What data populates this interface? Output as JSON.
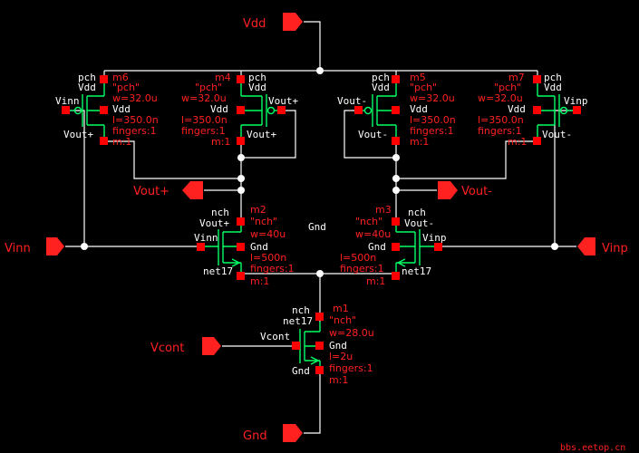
{
  "pins": {
    "vdd": "Vdd",
    "vout_plus": "Vout+",
    "vout_minus": "Vout-",
    "vinn": "Vinn",
    "vinp": "Vinp",
    "vcont": "Vcont",
    "gnd": "Gnd"
  },
  "net_gnd_label": "Gnd",
  "transistors": {
    "m6": {
      "inst": "m6",
      "type": "pch",
      "model": "\"pch\"",
      "w": "w=32.0u",
      "l": "l=350.0n",
      "fingers": "fingers:1",
      "m": "m:1",
      "gate": "Vinn",
      "drain": "Vout+",
      "source": "Vdd",
      "bulk": "Vdd"
    },
    "m4": {
      "inst": "m4",
      "type": "pch",
      "model": "\"pch\"",
      "w": "w=32.0u",
      "l": "l=350.0n",
      "fingers": "fingers:1",
      "m": "m:1",
      "gate": "Vout+",
      "drain": "Vout+",
      "source": "Vdd",
      "bulk": "Vdd"
    },
    "m5": {
      "inst": "m5",
      "type": "pch",
      "model": "\"pch\"",
      "w": "w=32.0u",
      "l": "l=350.0n",
      "fingers": "fingers:1",
      "m": "m:1",
      "gate": "Vout-",
      "drain": "Vout-",
      "source": "Vdd",
      "bulk": "Vdd"
    },
    "m7": {
      "inst": "m7",
      "type": "pch",
      "model": "\"pch\"",
      "w": "w=32.0u",
      "l": "l=350.0n",
      "fingers": "fingers:1",
      "m": "m:1",
      "gate": "Vinp",
      "drain": "Vout-",
      "source": "Vdd",
      "bulk": "Vdd"
    },
    "m2": {
      "inst": "m2",
      "type": "nch",
      "model": "\"nch\"",
      "w": "w=40u",
      "l": "l=500n",
      "fingers": "fingers:1",
      "m": "m:1",
      "gate": "Vinn",
      "drain": "Vout+",
      "source": "net17",
      "bulk": "Gnd"
    },
    "m3": {
      "inst": "m3",
      "type": "nch",
      "model": "\"nch\"",
      "w": "w=40u",
      "l": "l=500n",
      "fingers": "fingers:1",
      "m": "m:1",
      "gate": "Vinp",
      "drain": "Vout-",
      "source": "net17",
      "bulk": "Gnd"
    },
    "m1": {
      "inst": "m1",
      "type": "nch",
      "model": "\"nch\"",
      "w": "w=28.0u",
      "l": "l=2u",
      "fingers": "fingers:1",
      "m": "m:1",
      "gate": "Vcont",
      "drain": "net17",
      "source": "Gnd",
      "bulk": "Gnd"
    }
  },
  "watermark": "bbs.eetop.cn"
}
